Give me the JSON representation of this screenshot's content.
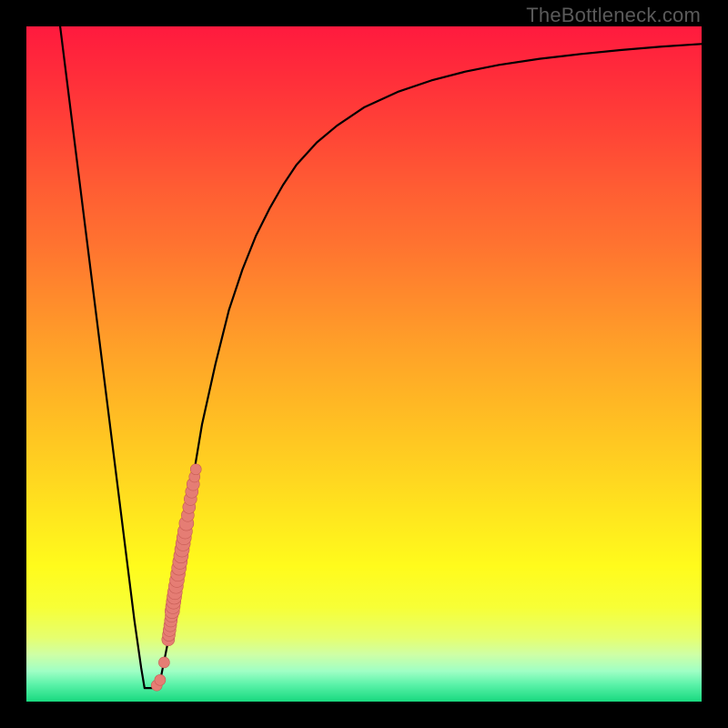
{
  "watermark": "TheBottleneck.com",
  "colors": {
    "curve": "#000000",
    "markers_fill": "#e57d74",
    "markers_stroke": "#c55a52",
    "frame": "#000000"
  },
  "chart_data": {
    "type": "line",
    "title": "",
    "xlabel": "",
    "ylabel": "",
    "xlim": [
      0,
      100
    ],
    "ylim": [
      0,
      100
    ],
    "grid": false,
    "series": [
      {
        "name": "bottleneck-curve",
        "x": [
          5,
          6,
          7,
          8,
          9,
          10,
          11,
          12,
          13,
          14,
          15,
          16,
          17,
          17.5,
          18,
          19,
          20,
          21,
          22,
          23,
          24,
          25,
          26,
          28,
          30,
          32,
          34,
          36,
          38,
          40,
          43,
          46,
          50,
          55,
          60,
          65,
          70,
          76,
          82,
          88,
          94,
          100
        ],
        "y": [
          100,
          92,
          84,
          76,
          68,
          60,
          52,
          44,
          36,
          28,
          20,
          12,
          5,
          2,
          2,
          2,
          4,
          9,
          15,
          22,
          29,
          35,
          41,
          50,
          58,
          64,
          69,
          73,
          76.5,
          79.5,
          82.8,
          85.3,
          88,
          90.3,
          92,
          93.3,
          94.3,
          95.2,
          95.9,
          96.5,
          97,
          97.4
        ]
      }
    ],
    "markers": {
      "name": "highlight-dots",
      "type": "scatter",
      "x": [
        19.3,
        19.8,
        20.4,
        21.0,
        21.1,
        21.2,
        21.3,
        21.4,
        21.5,
        21.6,
        21.7,
        21.8,
        21.9,
        22.0,
        22.15,
        22.3,
        22.45,
        22.6,
        22.75,
        22.9,
        23.05,
        23.2,
        23.35,
        23.5,
        23.7,
        23.9,
        24.1,
        24.3,
        24.5,
        24.7,
        24.9,
        25.1
      ],
      "y": [
        2.4,
        3.2,
        5.8,
        9.2,
        9.9,
        10.6,
        11.3,
        12.0,
        12.7,
        13.4,
        14.1,
        14.8,
        15.5,
        16.2,
        17.1,
        18.0,
        18.9,
        19.8,
        20.7,
        21.6,
        22.5,
        23.4,
        24.3,
        25.2,
        26.4,
        27.6,
        28.8,
        30.0,
        31.1,
        32.2,
        33.3,
        34.4
      ],
      "radius_px": [
        6,
        6,
        6,
        7,
        7,
        7,
        7,
        7,
        7,
        8,
        8,
        8,
        8,
        8,
        8,
        8,
        8,
        8,
        8,
        8,
        8,
        8,
        8,
        8,
        8,
        7,
        7,
        7,
        7,
        7,
        6,
        6
      ]
    }
  }
}
